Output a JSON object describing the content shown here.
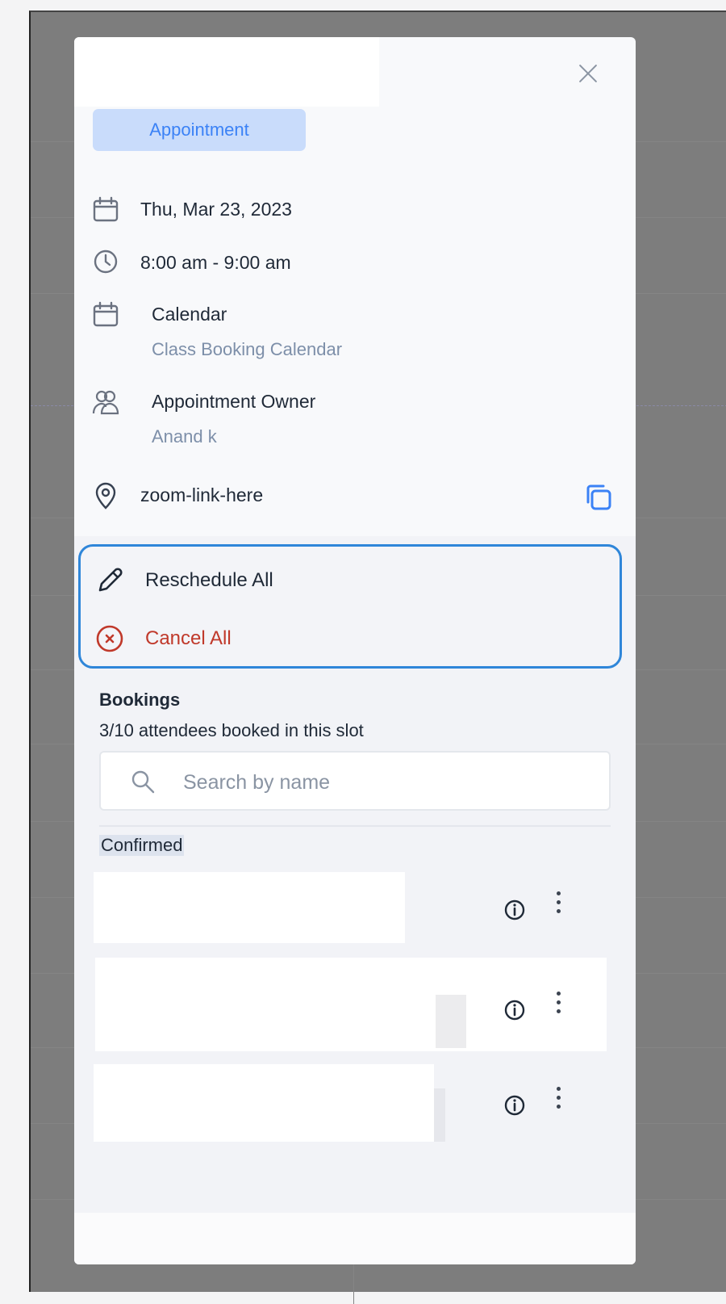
{
  "appointment": {
    "type_label": "Appointment",
    "date": "Thu, Mar 23, 2023",
    "time_range": "8:00 am - 9:00 am",
    "calendar_label": "Calendar",
    "calendar_name": "Class Booking Calendar",
    "owner_label": "Appointment Owner",
    "owner_name": "Anand k",
    "location": "zoom-link-here"
  },
  "actions": {
    "reschedule_all": "Reschedule All",
    "cancel_all": "Cancel All"
  },
  "bookings": {
    "title": "Bookings",
    "summary": "3/10 attendees booked in this slot",
    "search_placeholder": "Search by name",
    "confirmed_label": "Confirmed"
  },
  "icons": {
    "close": "close-icon",
    "date": "calendar-icon",
    "time": "clock-icon",
    "calendar": "calendar-icon",
    "owner": "users-icon",
    "location": "map-pin-icon",
    "copy": "copy-icon",
    "reschedule": "pencil-icon",
    "cancel": "x-circle-icon",
    "search": "search-icon",
    "attendee_info": "info-icon",
    "attendee_menu": "more-vertical-icon"
  },
  "colors": {
    "accent": "#3b82f6",
    "chip_background": "#c9dcfb",
    "focus_ring": "#2f86d9",
    "danger": "#c0392b",
    "secondary_text": "#7d8fa9"
  }
}
